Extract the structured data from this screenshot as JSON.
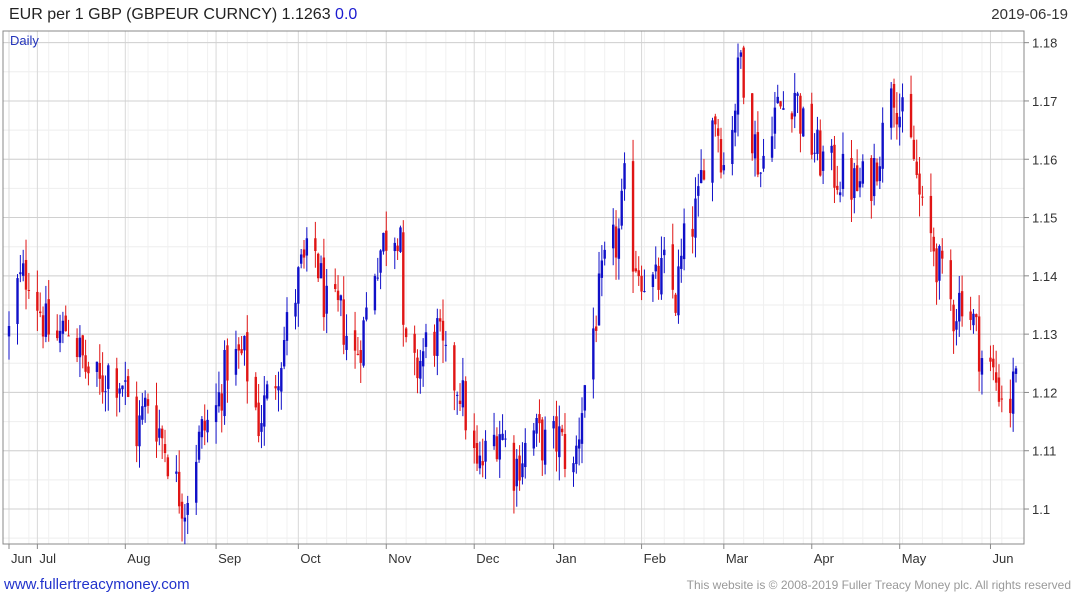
{
  "header": {
    "title": "EUR per 1 GBP (GBPEUR CURNCY) 1.1263",
    "change": "0.0",
    "date": "2019-06-19"
  },
  "footer": {
    "website": "www.fullertreacymoney.com",
    "copyright": "This website is © 2008-2019 Fuller Treacy Money plc. All rights reserved"
  },
  "chart_data": {
    "type": "bar",
    "subtype": "ohlc",
    "frequency_label": "Daily",
    "ylim": [
      1.094,
      1.182
    ],
    "yticks": [
      1.1,
      1.11,
      1.12,
      1.13,
      1.14,
      1.15,
      1.16,
      1.17,
      1.18
    ],
    "ytick_labels": [
      "1.1",
      "1.11",
      "1.12",
      "1.13",
      "1.14",
      "1.15",
      "1.16",
      "1.17",
      "1.18"
    ],
    "x_start": "2018-06-29",
    "x_end": "2019-06-19",
    "month_labels": [
      {
        "label": "Jun",
        "date": "2018-06-29"
      },
      {
        "label": "Jul",
        "date": "2018-07-09"
      },
      {
        "label": "Aug",
        "date": "2018-08-09"
      },
      {
        "label": "Sep",
        "date": "2018-09-10"
      },
      {
        "label": "Oct",
        "date": "2018-10-09"
      },
      {
        "label": "Nov",
        "date": "2018-11-09"
      },
      {
        "label": "Dec",
        "date": "2018-12-10"
      },
      {
        "label": "Jan",
        "date": "2019-01-07"
      },
      {
        "label": "Feb",
        "date": "2019-02-07"
      },
      {
        "label": "Mar",
        "date": "2019-03-08"
      },
      {
        "label": "Apr",
        "date": "2019-04-08"
      },
      {
        "label": "May",
        "date": "2019-05-09"
      },
      {
        "label": "Jun",
        "date": "2019-06-10"
      }
    ],
    "close_anchors": [
      [
        "2018-06-29",
        1.13
      ],
      [
        "2018-07-02",
        1.138
      ],
      [
        "2018-07-06",
        1.141
      ],
      [
        "2018-07-12",
        1.131
      ],
      [
        "2018-07-16",
        1.129
      ],
      [
        "2018-07-20",
        1.132
      ],
      [
        "2018-07-26",
        1.124
      ],
      [
        "2018-07-31",
        1.121
      ],
      [
        "2018-08-03",
        1.124
      ],
      [
        "2018-08-08",
        1.122
      ],
      [
        "2018-08-13",
        1.113
      ],
      [
        "2018-08-17",
        1.119
      ],
      [
        "2018-08-23",
        1.111
      ],
      [
        "2018-08-27",
        1.104
      ],
      [
        "2018-08-30",
        1.101
      ],
      [
        "2018-09-03",
        1.11
      ],
      [
        "2018-09-05",
        1.113
      ],
      [
        "2018-09-10",
        1.117
      ],
      [
        "2018-09-14",
        1.125
      ],
      [
        "2018-09-20",
        1.126
      ],
      [
        "2018-09-25",
        1.115
      ],
      [
        "2018-10-01",
        1.123
      ],
      [
        "2018-10-05",
        1.131
      ],
      [
        "2018-10-10",
        1.141
      ],
      [
        "2018-10-15",
        1.144
      ],
      [
        "2018-10-19",
        1.134
      ],
      [
        "2018-10-24",
        1.133
      ],
      [
        "2018-10-29",
        1.126
      ],
      [
        "2018-11-01",
        1.131
      ],
      [
        "2018-11-05",
        1.142
      ],
      [
        "2018-11-09",
        1.147
      ],
      [
        "2018-11-14",
        1.149
      ],
      [
        "2018-11-15",
        1.128
      ],
      [
        "2018-11-19",
        1.123
      ],
      [
        "2018-11-23",
        1.128
      ],
      [
        "2018-11-27",
        1.13
      ],
      [
        "2018-11-30",
        1.124
      ],
      [
        "2018-12-05",
        1.121
      ],
      [
        "2018-12-11",
        1.106
      ],
      [
        "2018-12-14",
        1.109
      ],
      [
        "2018-12-19",
        1.114
      ],
      [
        "2018-12-24",
        1.107
      ],
      [
        "2018-12-31",
        1.113
      ],
      [
        "2019-01-04",
        1.111
      ],
      [
        "2019-01-09",
        1.112
      ],
      [
        "2019-01-14",
        1.106
      ],
      [
        "2019-01-17",
        1.118
      ],
      [
        "2019-01-21",
        1.131
      ],
      [
        "2019-01-25",
        1.141
      ],
      [
        "2019-01-30",
        1.147
      ],
      [
        "2019-02-01",
        1.155
      ],
      [
        "2019-02-04",
        1.144
      ],
      [
        "2019-02-08",
        1.14
      ],
      [
        "2019-02-12",
        1.138
      ],
      [
        "2019-02-15",
        1.141
      ],
      [
        "2019-02-19",
        1.136
      ],
      [
        "2019-02-22",
        1.145
      ],
      [
        "2019-02-27",
        1.152
      ],
      [
        "2019-03-01",
        1.161
      ],
      [
        "2019-03-05",
        1.168
      ],
      [
        "2019-03-08",
        1.159
      ],
      [
        "2019-03-12",
        1.17
      ],
      [
        "2019-03-14",
        1.178
      ],
      [
        "2019-03-18",
        1.165
      ],
      [
        "2019-03-21",
        1.158
      ],
      [
        "2019-03-25",
        1.168
      ],
      [
        "2019-03-29",
        1.169
      ],
      [
        "2019-04-02",
        1.172
      ],
      [
        "2019-04-05",
        1.165
      ],
      [
        "2019-04-10",
        1.161
      ],
      [
        "2019-04-15",
        1.158
      ],
      [
        "2019-04-19",
        1.157
      ],
      [
        "2019-04-24",
        1.155
      ],
      [
        "2019-04-29",
        1.157
      ],
      [
        "2019-05-03",
        1.164
      ],
      [
        "2019-05-06",
        1.175
      ],
      [
        "2019-05-09",
        1.168
      ],
      [
        "2019-05-14",
        1.16
      ],
      [
        "2019-05-17",
        1.15
      ],
      [
        "2019-05-21",
        1.145
      ],
      [
        "2019-05-24",
        1.139
      ],
      [
        "2019-05-28",
        1.134
      ],
      [
        "2019-05-31",
        1.137
      ],
      [
        "2019-06-04",
        1.132
      ],
      [
        "2019-06-07",
        1.126
      ],
      [
        "2019-06-11",
        1.123
      ],
      [
        "2019-06-14",
        1.12
      ],
      [
        "2019-06-17",
        1.118
      ],
      [
        "2019-06-18",
        1.121
      ],
      [
        "2019-06-19",
        1.1263
      ]
    ],
    "up_color": "#1010c8",
    "down_color": "#e01515",
    "grid": true,
    "axis_color": "#888888"
  }
}
